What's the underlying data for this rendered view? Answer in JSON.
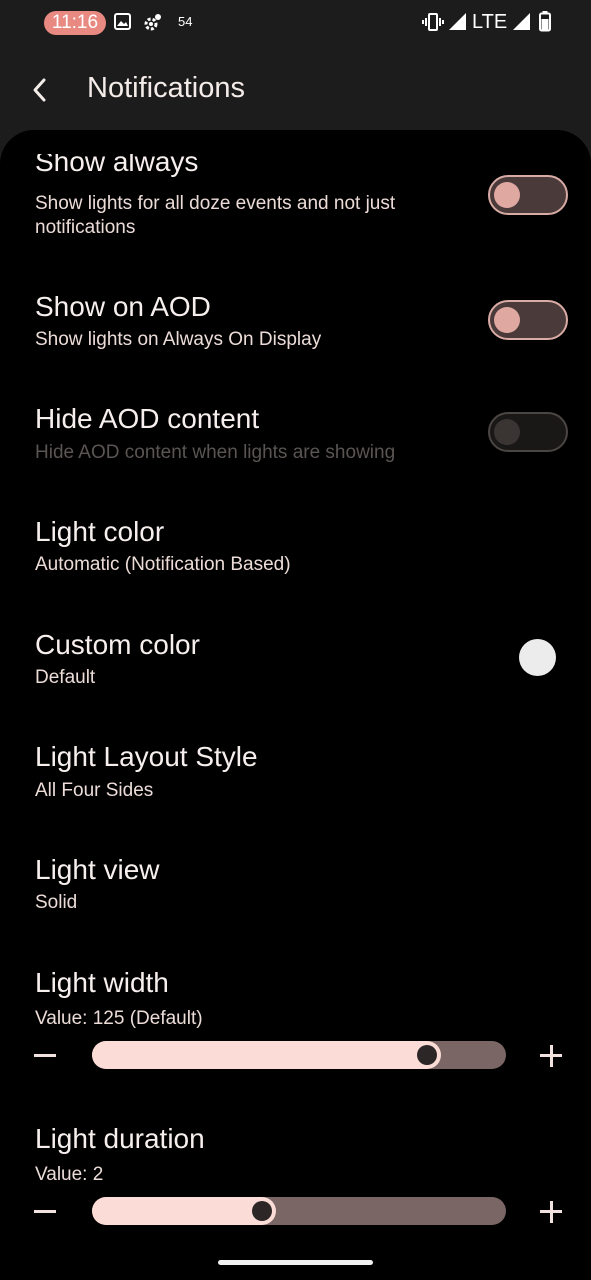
{
  "status_bar": {
    "time": "11:16",
    "notif_count": "54",
    "network": "LTE",
    "icons": [
      "image-icon",
      "settings-gear-icon",
      "vibrate-icon",
      "signal-icon",
      "battery-icon"
    ]
  },
  "app_bar": {
    "title": "Notifications",
    "back_icon": "back-arrow-icon"
  },
  "preferences": {
    "show_always": {
      "title": "Show always",
      "summary": "Show lights for all doze events and not just notifications",
      "enabled": false
    },
    "show_on_aod": {
      "title": "Show on AOD",
      "summary": "Show lights on Always On Display",
      "enabled": false
    },
    "hide_aod_content": {
      "title": "Hide AOD content",
      "summary": "Hide AOD content when lights are showing",
      "enabled": false,
      "disabled": true
    },
    "light_color": {
      "title": "Light color",
      "summary": "Automatic (Notification Based)"
    },
    "custom_color": {
      "title": "Custom color",
      "summary": "Default",
      "swatch_color": "#ececec"
    },
    "light_layout_style": {
      "title": "Light Layout Style",
      "summary": "All Four Sides"
    },
    "light_view": {
      "title": "Light view",
      "summary": "Solid"
    },
    "light_width": {
      "title": "Light width",
      "summary": "Value: 125 (Default)",
      "slider_fraction": 0.81
    },
    "light_duration": {
      "title": "Light duration",
      "summary": "Value: 2",
      "slider_fraction": 0.41
    }
  },
  "colors": {
    "accent": "#fbdcd6",
    "time_pill": "#e88a82",
    "toggle_knob": "#dfa9a2"
  }
}
